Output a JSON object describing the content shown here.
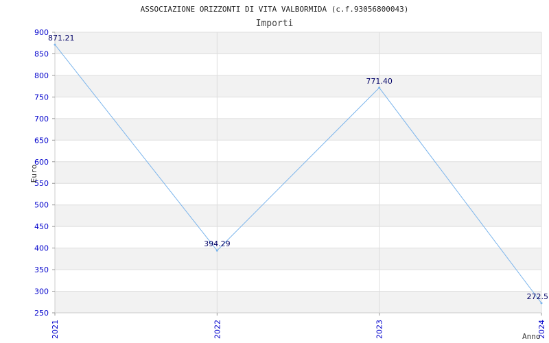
{
  "chart_data": {
    "type": "line",
    "title": "ASSOCIAZIONE ORIZZONTI DI VITA VALBORMIDA (c.f.93056800043)",
    "subtitle": "Importi",
    "xlabel": "Anno",
    "ylabel": "Euro",
    "categories": [
      "2021",
      "2022",
      "2023",
      "2024"
    ],
    "series": [
      {
        "values": [
          871.21,
          394.29,
          771.4,
          272.5
        ]
      }
    ],
    "data_labels": [
      "871.21",
      "394.29",
      "771.40",
      "272.5"
    ],
    "y_ticks": [
      250,
      300,
      350,
      400,
      450,
      500,
      550,
      600,
      650,
      700,
      750,
      800,
      850,
      900
    ],
    "ylim": [
      250,
      900
    ],
    "grid": true,
    "colors": {
      "line": "#7cb5ec",
      "band": "#f2f2f2",
      "gridline": "#dddddd",
      "tick_label": "#0000cc",
      "data_label": "#000066"
    }
  }
}
